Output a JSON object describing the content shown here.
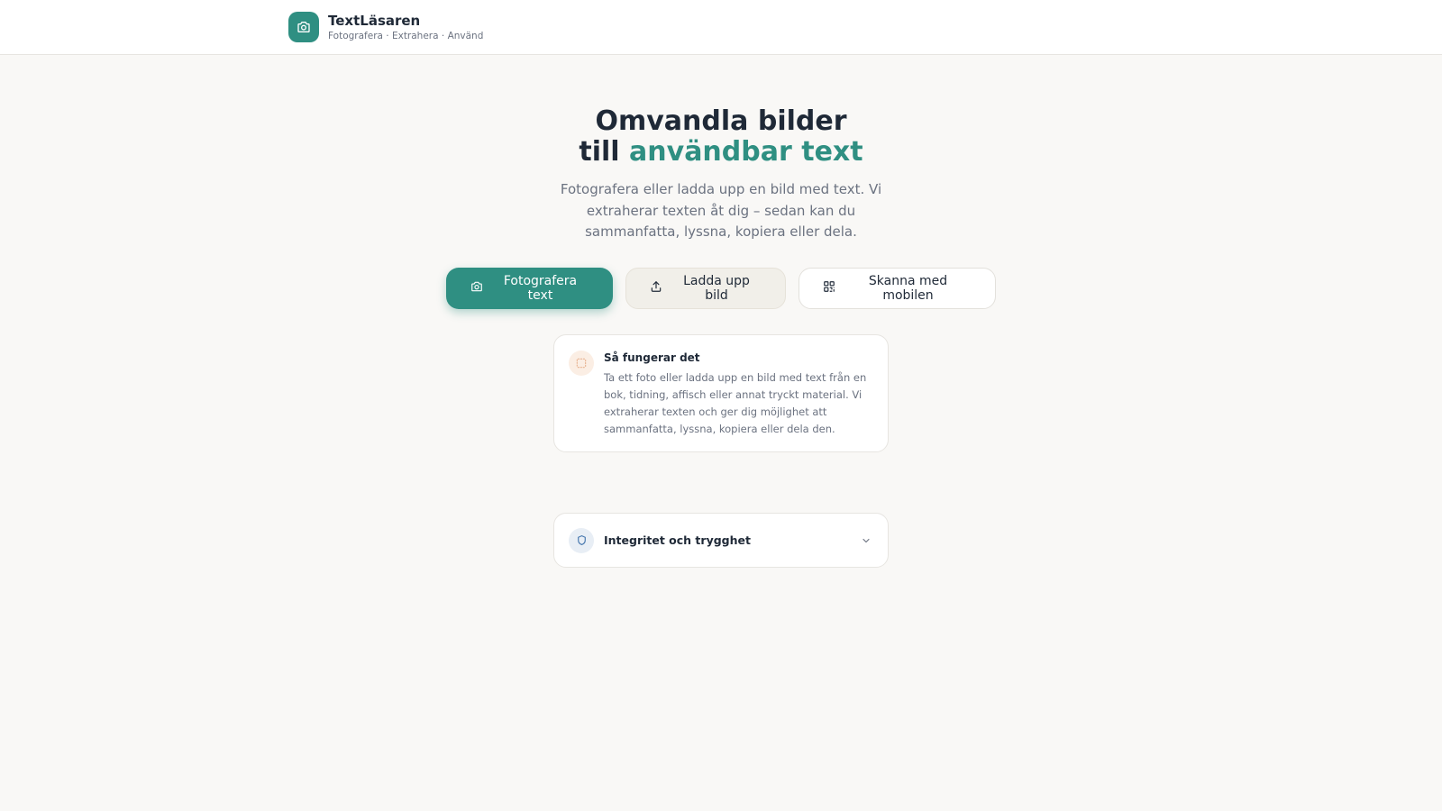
{
  "header": {
    "app_title": "TextLäsaren",
    "tagline": "Fotografera · Extrahera · Använd",
    "logo_icon": "camera-icon",
    "brand_color": "#2f8f82"
  },
  "hero": {
    "title_line1": "Omvandla bilder",
    "title_line2_prefix": "till ",
    "title_line2_accent": "användbar text",
    "subtitle": "Fotografera eller ladda upp en bild med text. Vi extraherar texten åt dig – sedan kan du sammanfatta, lyssna, kopiera eller dela."
  },
  "actions": {
    "photo_label": "Fotografera text",
    "photo_icon": "camera-icon",
    "upload_label": "Ladda upp bild",
    "upload_icon": "upload-icon",
    "scan_label": "Skanna med mobilen",
    "scan_icon": "qr-code-icon"
  },
  "info_card": {
    "icon": "scan-frame-icon",
    "title": "Så fungerar det",
    "text": "Ta ett foto eller ladda upp en bild med text från en bok, tidning, affisch eller annat tryckt material. Vi extraherar texten och ger dig möjlighet att sammanfatta, lyssna, kopiera eller dela den."
  },
  "privacy": {
    "icon": "shield-icon",
    "label": "Integritet och trygghet",
    "toggle_icon": "chevron-down-icon",
    "expanded": false
  }
}
